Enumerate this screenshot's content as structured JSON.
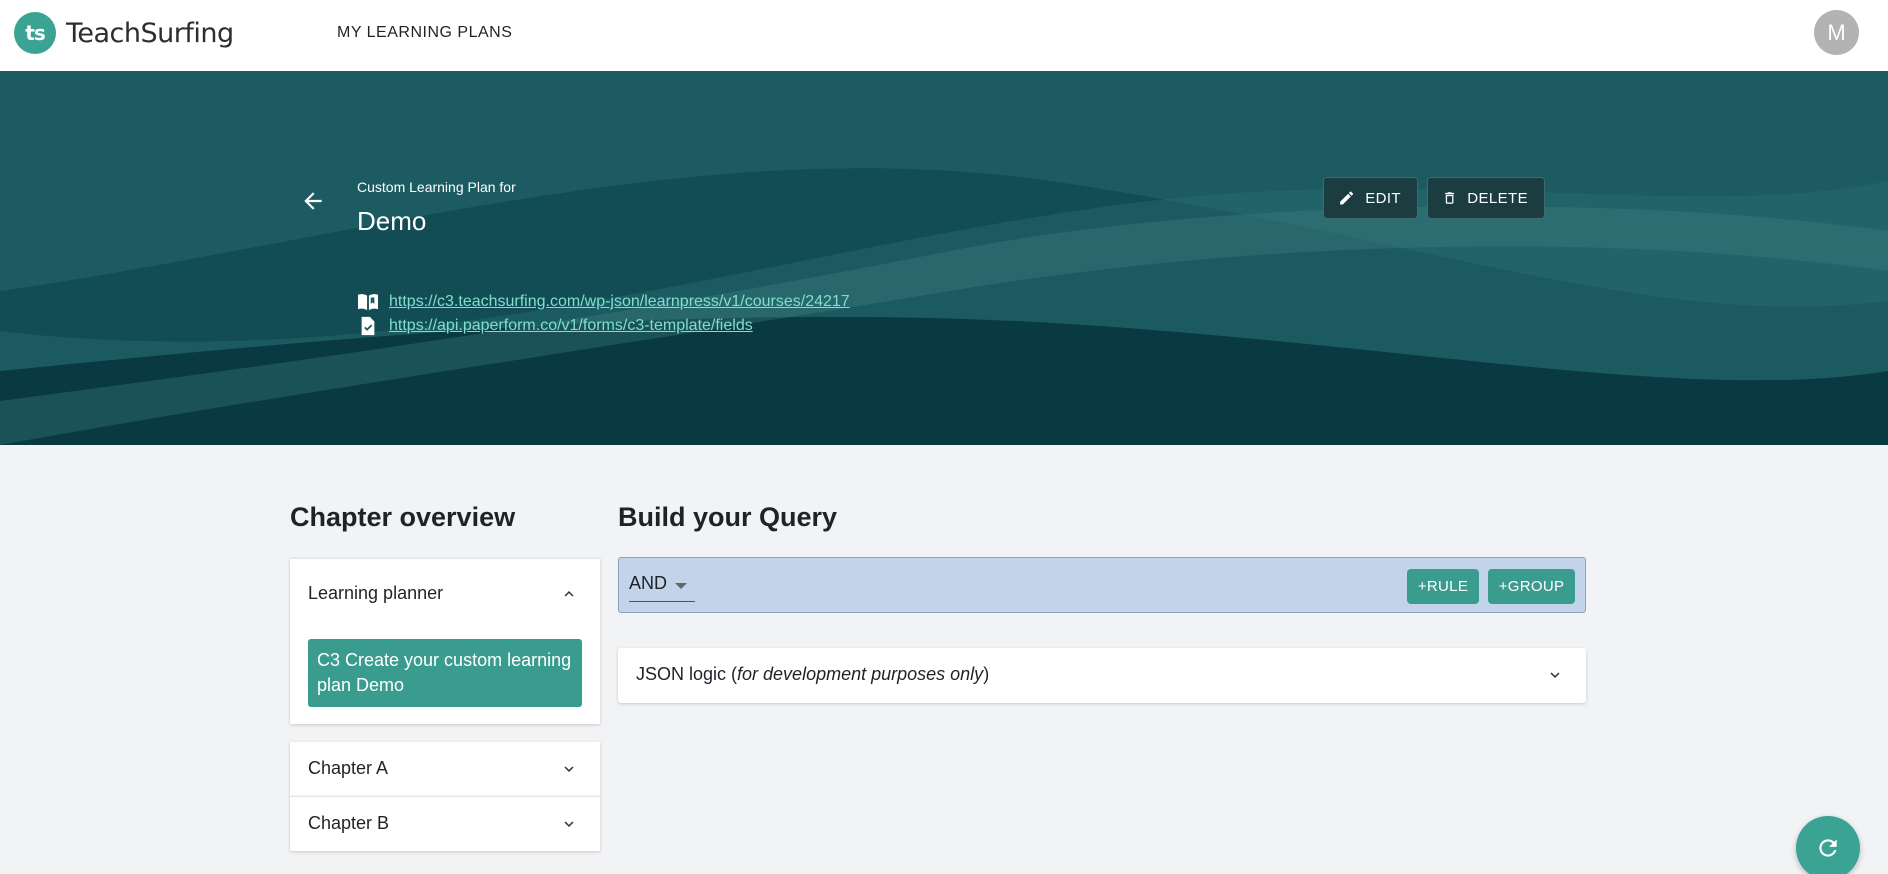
{
  "app": {
    "name": "TeachSurfing",
    "logo_mark": "ts"
  },
  "nav": {
    "learning_plans": "MY LEARNING PLANS"
  },
  "user": {
    "avatar_initial": "M"
  },
  "hero": {
    "subtitle": "Custom Learning Plan for",
    "title": "Demo",
    "edit_label": "EDIT",
    "delete_label": "DELETE",
    "course_link": "https://c3.teachsurfing.com/wp-json/learnpress/v1/courses/24217",
    "form_link": "https://api.paperform.co/v1/forms/c3-template/fields"
  },
  "chapters": {
    "title": "Chapter overview",
    "planner": {
      "label": "Learning planner",
      "item": "C3 Create your custom learning plan Demo"
    },
    "chapter_a": "Chapter A",
    "chapter_b": "Chapter B"
  },
  "query": {
    "title": "Build your Query",
    "combinator": "AND",
    "add_rule": "+RULE",
    "add_group": "+GROUP",
    "json_logic_prefix": "JSON logic (",
    "json_logic_note": "for development purposes only",
    "json_logic_suffix": ")"
  },
  "colors": {
    "accent": "#3aa394",
    "hero_bg": "#1c5b62",
    "link": "#7ee0cc",
    "query_bg": "#c3d3ea"
  },
  "icons": [
    "back-arrow-icon",
    "pencil-icon",
    "trash-icon",
    "book-icon",
    "file-check-icon",
    "chevron-up-icon",
    "chevron-down-icon",
    "refresh-icon"
  ]
}
